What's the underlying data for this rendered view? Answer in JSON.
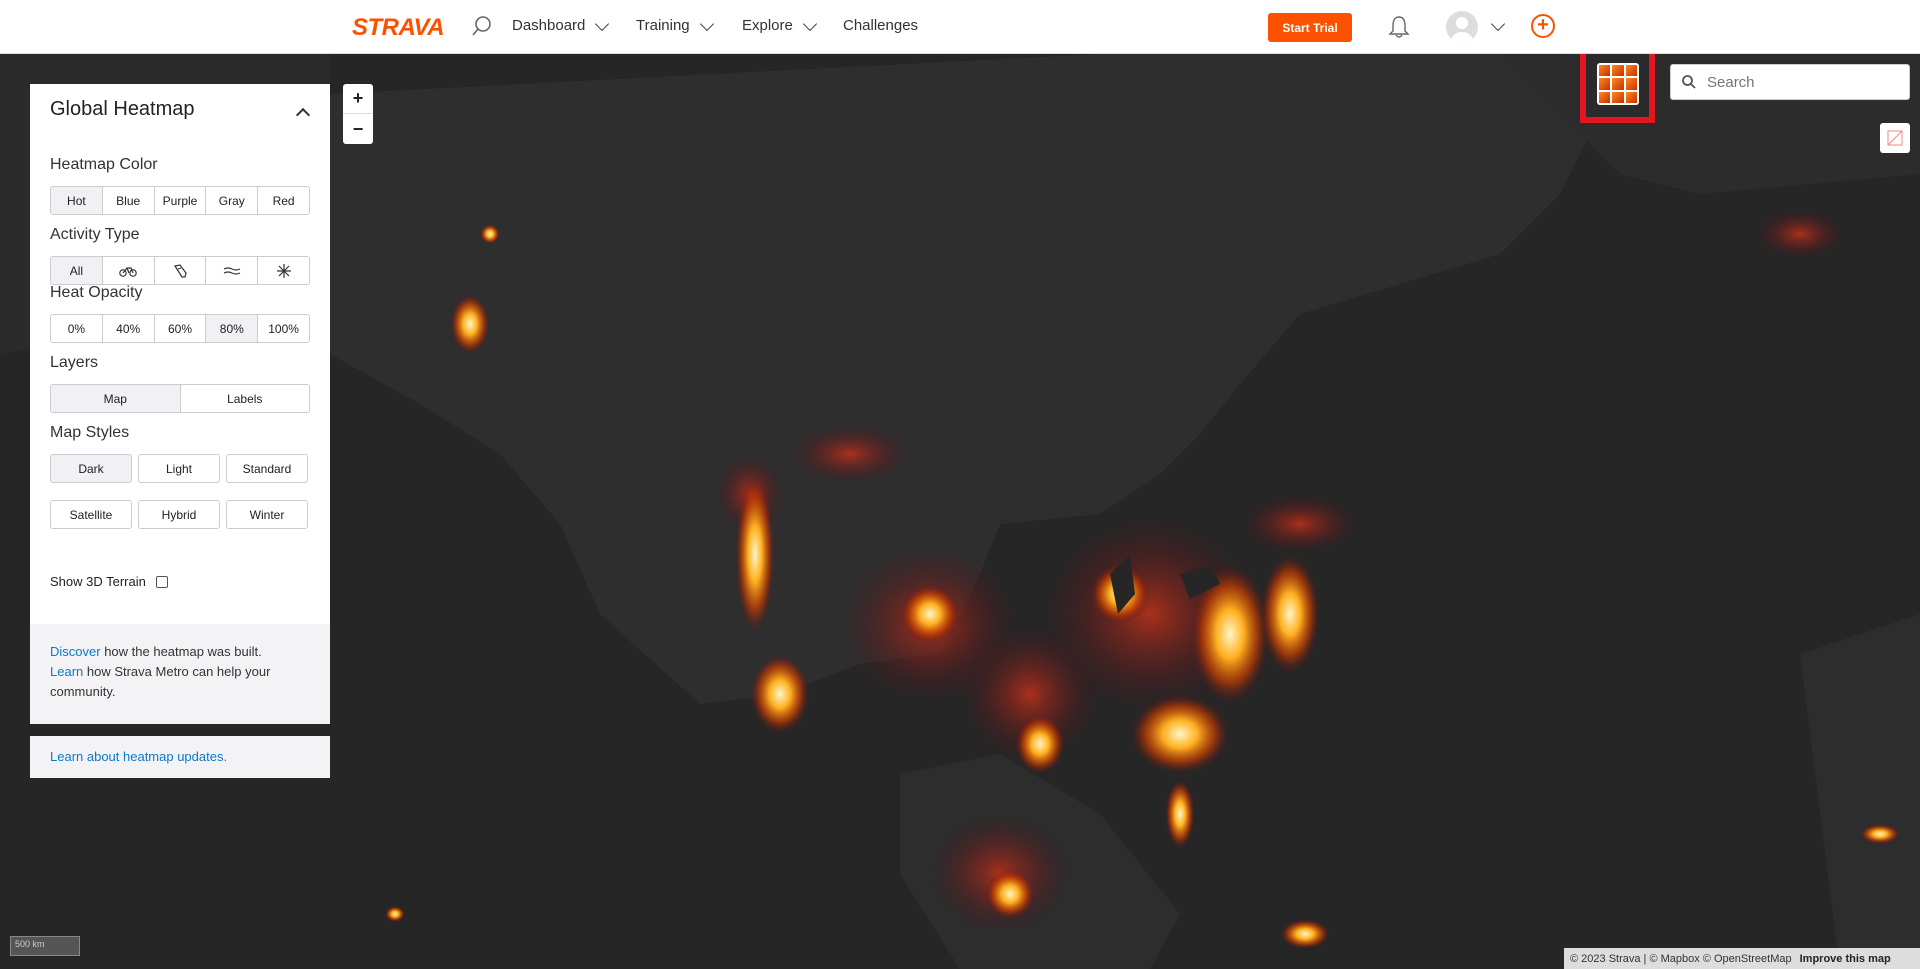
{
  "nav": {
    "logo": "STRAVA",
    "dashboard": "Dashboard",
    "training": "Training",
    "explore": "Explore",
    "challenges": "Challenges",
    "start_trial": "Start Trial"
  },
  "panel": {
    "title": "Global Heatmap",
    "heatmap_color_label": "Heatmap Color",
    "heatmap_colors": [
      "Hot",
      "Blue",
      "Purple",
      "Gray",
      "Red"
    ],
    "activity_type_label": "Activity Type",
    "activity_all": "All",
    "activity_icons": [
      "bike-icon",
      "shoe-icon",
      "water-icon",
      "snowflake-icon"
    ],
    "opacity_label": "Heat Opacity",
    "opacities": [
      "0%",
      "40%",
      "60%",
      "80%",
      "100%"
    ],
    "layers_label": "Layers",
    "layers": [
      "Map",
      "Labels"
    ],
    "map_styles_label": "Map Styles",
    "map_styles": [
      "Dark",
      "Light",
      "Standard",
      "Satellite",
      "Hybrid",
      "Winter"
    ],
    "terrain_label": "Show 3D Terrain",
    "discover_link": "Discover",
    "discover_text": " how the heatmap was built.",
    "learn_link": "Learn",
    "learn_text": " how Strava Metro can help your community.",
    "updates_link": "Learn about heatmap updates."
  },
  "search": {
    "placeholder": "Search"
  },
  "scale": "500 km",
  "attribution": {
    "text": "© 2023 Strava | © Mapbox © OpenStreetMap",
    "improve": "Improve this map"
  },
  "colors": {
    "accent": "#fc5200",
    "highlight": "#e3161f",
    "map_bg": "#262626"
  }
}
